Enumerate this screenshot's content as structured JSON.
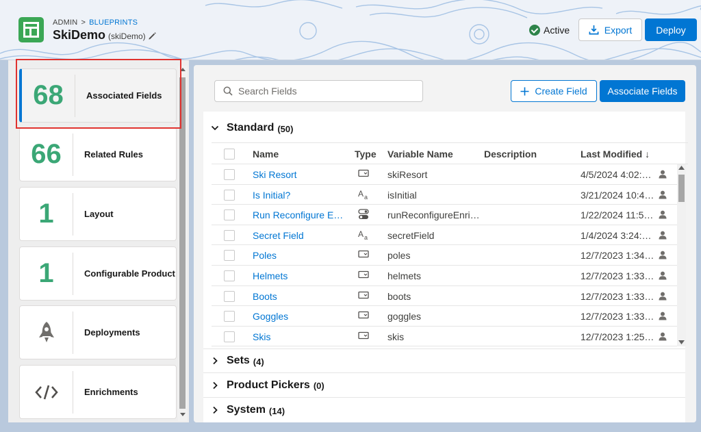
{
  "header": {
    "breadcrumb": [
      "ADMIN",
      "BLUEPRINTS"
    ],
    "breadcrumb_sep": ">",
    "title": "SkiDemo",
    "subtitle": "(skiDemo)",
    "status": "Active",
    "export_label": "Export",
    "deploy_label": "Deploy"
  },
  "sidebar": {
    "items": [
      {
        "value": "68",
        "label": "Associated Fields",
        "icon": null
      },
      {
        "value": "66",
        "label": "Related Rules",
        "icon": null
      },
      {
        "value": "1",
        "label": "Layout",
        "icon": null
      },
      {
        "value": "1",
        "label": "Configurable Product",
        "icon": null
      },
      {
        "value": "",
        "label": "Deployments",
        "icon": "rocket-icon"
      },
      {
        "value": "",
        "label": "Enrichments",
        "icon": "code-icon"
      }
    ]
  },
  "toolbar": {
    "search_placeholder": "Search Fields",
    "create_label": "Create Field",
    "associate_label": "Associate Fields"
  },
  "sections": {
    "standard": {
      "name": "Standard",
      "count": "(50)"
    },
    "sets": {
      "name": "Sets",
      "count": "(4)"
    },
    "pickers": {
      "name": "Product Pickers",
      "count": "(0)"
    },
    "system": {
      "name": "System",
      "count": "(14)"
    }
  },
  "table": {
    "columns": {
      "name": "Name",
      "type": "Type",
      "variable": "Variable Name",
      "description": "Description",
      "modified": "Last Modified",
      "sort_arrow": "↓"
    },
    "rows": [
      {
        "name": "Ski Resort",
        "type": "picklist-icon",
        "variable": "skiResort",
        "modified": "4/5/2024 4:02:00..."
      },
      {
        "name": "Is Initial?",
        "type": "text-icon",
        "variable": "isInitial",
        "modified": "3/21/2024 10:46:..."
      },
      {
        "name": "Run Reconfigure Enr...",
        "type": "toggle-icon",
        "variable": "runReconfigureEnric...",
        "modified": "1/22/2024 11:55:..."
      },
      {
        "name": "Secret Field",
        "type": "text-icon",
        "variable": "secretField",
        "modified": "1/4/2024 3:24:06..."
      },
      {
        "name": "Poles",
        "type": "picklist-icon",
        "variable": "poles",
        "modified": "12/7/2023 1:34:0..."
      },
      {
        "name": "Helmets",
        "type": "picklist-icon",
        "variable": "helmets",
        "modified": "12/7/2023 1:33:4..."
      },
      {
        "name": "Boots",
        "type": "picklist-icon",
        "variable": "boots",
        "modified": "12/7/2023 1:33:3..."
      },
      {
        "name": "Goggles",
        "type": "picklist-icon",
        "variable": "goggles",
        "modified": "12/7/2023 1:33:2..."
      },
      {
        "name": "Skis",
        "type": "picklist-icon",
        "variable": "skis",
        "modified": "12/7/2023 1:25:3..."
      }
    ]
  },
  "colors": {
    "brand": "#0176d3",
    "accent_green": "#3ba776",
    "highlight": "#e0322f"
  }
}
